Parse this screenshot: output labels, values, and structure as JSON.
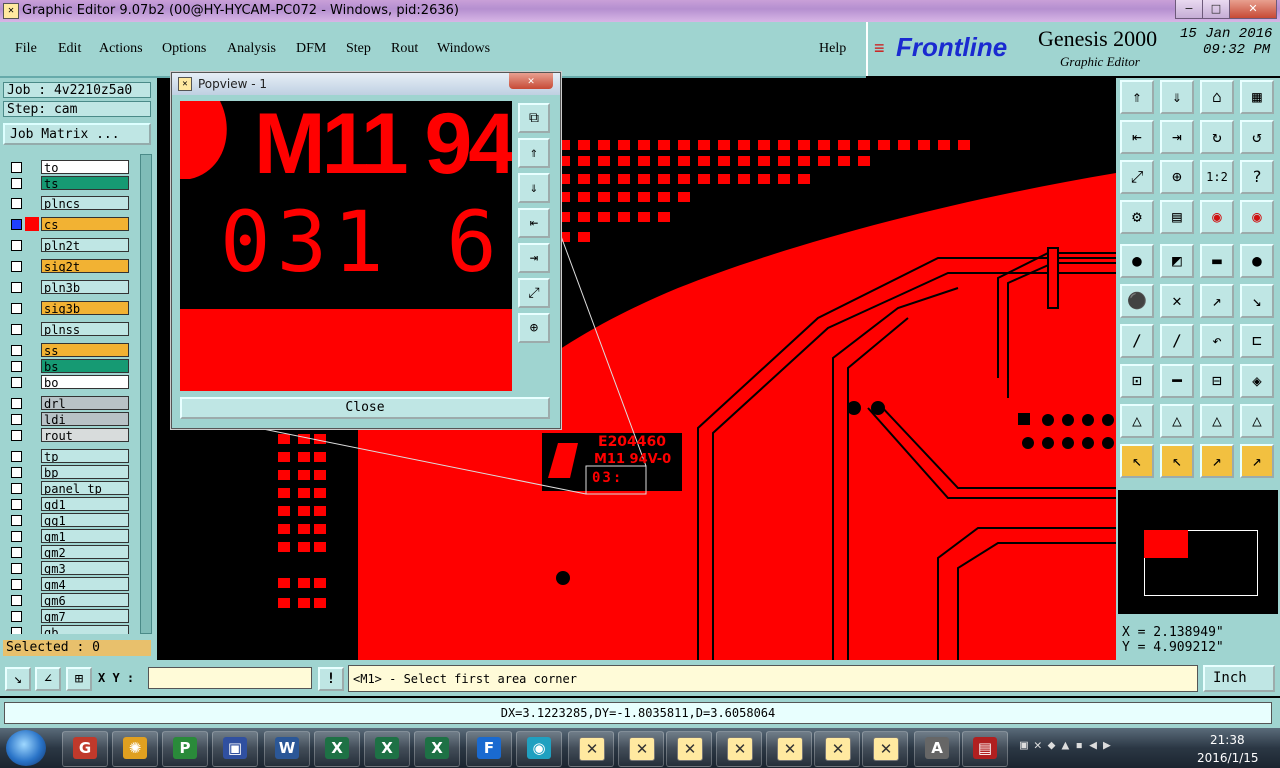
{
  "window": {
    "title": "Graphic Editor 9.07b2 (00@HY-HYCAM-PC072 - Windows, pid:2636)",
    "minimize": "−",
    "maximize": "□",
    "close": "✕"
  },
  "menu": {
    "file": "File",
    "edit": "Edit",
    "actions": "Actions",
    "options": "Options",
    "analysis": "Analysis",
    "dfm": "DFM",
    "step": "Step",
    "rout": "Rout",
    "windows": "Windows",
    "help": "Help"
  },
  "brand": {
    "logo": "Frontline",
    "product": "Genesis 2000",
    "subtitle": "Graphic Editor",
    "date": "15 Jan 2016",
    "time": "09:32 PM"
  },
  "left": {
    "job": "Job : 4v2210z5a0",
    "step": "Step: cam",
    "job_matrix": "Job Matrix ...",
    "selected": "Selected : 0",
    "layers": [
      {
        "name": "to",
        "color": "#ffffff"
      },
      {
        "name": "ts",
        "color": "#169a73"
      },
      {
        "name": "plncs",
        "color": "#bfe6e4"
      },
      {
        "name": "cs",
        "color": "#f2b233"
      },
      {
        "name": "pln2t",
        "color": "#bfe6e4"
      },
      {
        "name": "sig2t",
        "color": "#f2b233"
      },
      {
        "name": "pln3b",
        "color": "#bfe6e4"
      },
      {
        "name": "sig3b",
        "color": "#f2b233"
      },
      {
        "name": "plnss",
        "color": "#bfe6e4"
      },
      {
        "name": "ss",
        "color": "#f2b233"
      },
      {
        "name": "bs",
        "color": "#169a73"
      },
      {
        "name": "bo",
        "color": "#ffffff"
      },
      {
        "name": "drl",
        "color": "#b8c2c6"
      },
      {
        "name": "ldi",
        "color": "#b8c2c6"
      },
      {
        "name": "rout",
        "color": "#d8dcdc"
      },
      {
        "name": "tp",
        "color": "#bfe6e4"
      },
      {
        "name": "bp",
        "color": "#bfe6e4"
      },
      {
        "name": "panel_tp",
        "color": "#bfe6e4"
      },
      {
        "name": "gd1",
        "color": "#bfe6e4"
      },
      {
        "name": "gg1",
        "color": "#bfe6e4"
      },
      {
        "name": "gm1",
        "color": "#bfe6e4"
      },
      {
        "name": "gm2",
        "color": "#bfe6e4"
      },
      {
        "name": "gm3",
        "color": "#bfe6e4"
      },
      {
        "name": "gm4",
        "color": "#bfe6e4"
      },
      {
        "name": "gm6",
        "color": "#bfe6e4"
      },
      {
        "name": "gm7",
        "color": "#bfe6e4"
      },
      {
        "name": "gb",
        "color": "#bfe6e4"
      }
    ]
  },
  "popview": {
    "title": "Popview - 1",
    "close": "Close",
    "text_top": "M11 94",
    "text_digits": "031 6"
  },
  "canvas": {
    "label1": "E204460",
    "label2": "M11 94V-0",
    "label3": "03:"
  },
  "coords": {
    "x": "X = 2.138949\"",
    "y": "Y = 4.909212\""
  },
  "status": {
    "xy_label": "X Y :",
    "bang": "!",
    "prompt": "<M1> - Select first area corner",
    "units": "Inch",
    "measure": "DX=3.1223285,DY=-1.8035811,D=3.6058064"
  },
  "taskbar": {
    "time": "21:38",
    "date": "2016/1/15"
  },
  "colors": {
    "copper": "#ff0000",
    "panel": "#9fd4d0"
  }
}
